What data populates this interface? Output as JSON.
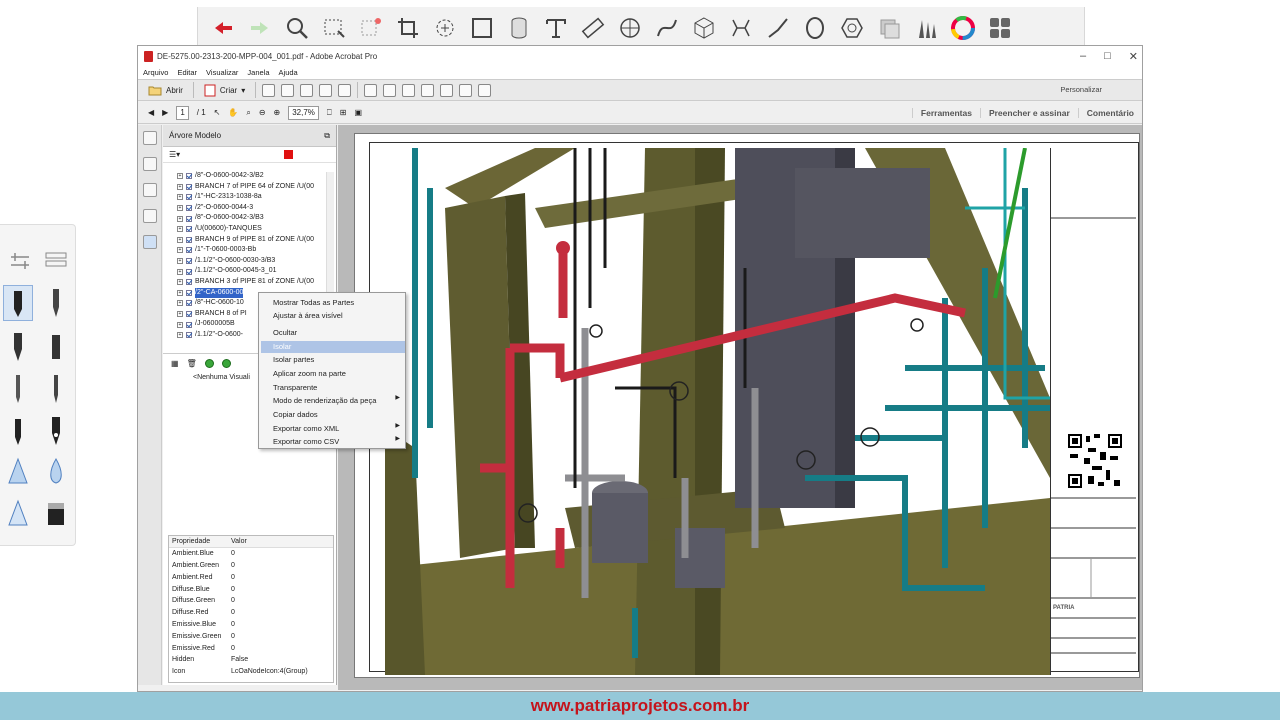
{
  "annotation_toolbar": {
    "icons": [
      "undo-icon",
      "redo-icon",
      "search-icon",
      "select-icon",
      "shape-select-icon",
      "crop-icon",
      "lasso-icon",
      "rectangle-icon",
      "cylinder-icon",
      "text-icon",
      "ruler-icon",
      "compass-icon",
      "curve-icon",
      "cube-icon",
      "measure-icon",
      "line-icon",
      "circle-icon",
      "hexagon-icon",
      "eraser-icon",
      "pens-icon",
      "color-wheel-icon",
      "grid-icon"
    ]
  },
  "window": {
    "title": "DE-5275.00-2313-200-MPP-004_001.pdf - Adobe Acrobat Pro",
    "controls": [
      "–",
      "□",
      "✕"
    ]
  },
  "menu": [
    "Arquivo",
    "Editar",
    "Visualizar",
    "Janela",
    "Ajuda"
  ],
  "toolbar": {
    "open_label": "Abrir",
    "create_label": "Criar",
    "personalize_label": "Personalizar",
    "page_current": "1",
    "page_total": "/ 1",
    "zoom": "32,7%"
  },
  "right_tabs": [
    "Ferramentas",
    "Preencher e assinar",
    "Comentário"
  ],
  "model_panel": {
    "title": "Árvore Modelo",
    "tree": [
      "/8\"-O-0600-0042-3/B2",
      "BRANCH 7 of PIPE 64 of ZONE /U(00",
      "/1\"-HC-2313-1038-8a",
      "/2\"-O-0600-0044-3",
      "/8\"-O-0600-0042-3/B3",
      "/U(00600)-TANQUES",
      "BRANCH 9 of PIPE 81 of ZONE /U(00",
      "/1\"-T-0600-0003-Bb",
      "/1.1/2\"-O-0600-0030-3/B3",
      "/1.1/2\"-O-0600-0045-3_01",
      "BRANCH 3 of PIPE 81 of ZONE /U(00",
      "/2\"-CA-0600-00",
      "/8\"-HC-0600-10",
      "BRANCH 8 of PI",
      "/J-0600005B",
      "/1.1/2\"-O-0600-"
    ],
    "selected_index": 11,
    "no_views": "<Nenhuma Visuali"
  },
  "properties": {
    "header": [
      "Propriedade",
      "Valor"
    ],
    "rows": [
      [
        "Ambient.Blue",
        "0"
      ],
      [
        "Ambient.Green",
        "0"
      ],
      [
        "Ambient.Red",
        "0"
      ],
      [
        "Diffuse.Blue",
        "0"
      ],
      [
        "Diffuse.Green",
        "0"
      ],
      [
        "Diffuse.Red",
        "0"
      ],
      [
        "Emissive.Blue",
        "0"
      ],
      [
        "Emissive.Green",
        "0"
      ],
      [
        "Emissive.Red",
        "0"
      ],
      [
        "Hidden",
        "False"
      ],
      [
        "Icon",
        "LcOaNodeIcon:4(Group)"
      ]
    ]
  },
  "context_menu": {
    "items": [
      {
        "label": "Mostrar Todas as Partes",
        "submenu": false
      },
      {
        "label": "Ajustar à área visível",
        "submenu": false
      },
      {
        "label": "Ocultar",
        "submenu": false
      },
      {
        "label": "Isolar",
        "submenu": false
      },
      {
        "label": "Isolar partes",
        "submenu": false
      },
      {
        "label": "Aplicar zoom na parte",
        "submenu": false
      },
      {
        "label": "Transparente",
        "submenu": false
      },
      {
        "label": "Modo de renderização da peça",
        "submenu": true
      },
      {
        "label": "Copiar dados",
        "submenu": false
      },
      {
        "label": "Exportar como XML",
        "submenu": true
      },
      {
        "label": "Exportar como CSV",
        "submenu": true
      }
    ],
    "highlighted": "Isolar"
  },
  "drawing": {
    "logo_text": "PATRIA"
  },
  "banner": {
    "text": "www.patriaprojetos.com.br",
    "bg": "#95c8d8",
    "fg": "#c4141c"
  },
  "colors": {
    "pipe_teal": "#167c86",
    "pipe_red": "#c42d3e",
    "steel_olive": "#5b5a2e",
    "vessel_gray": "#4e4e5a"
  }
}
